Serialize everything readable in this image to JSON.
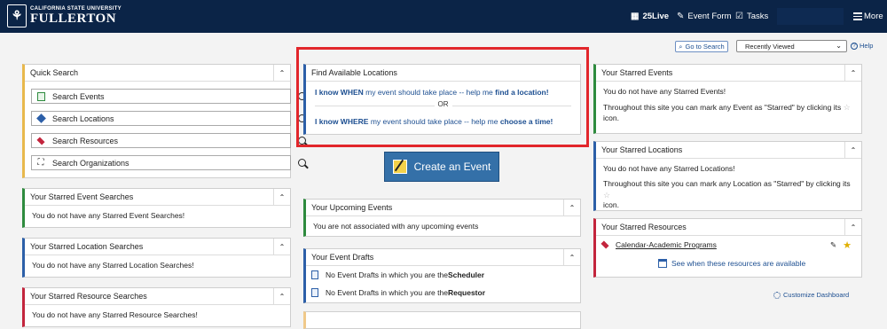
{
  "header": {
    "logo_small": "CALIFORNIA STATE UNIVERSITY",
    "logo_big": "FULLERTON",
    "nav_25live": "25Live",
    "nav_event_form": "Event Form",
    "nav_tasks": "Tasks",
    "nav_more": "More"
  },
  "toolbar": {
    "go_to_search": "Go to Search",
    "recently_viewed": "Recently Viewed",
    "help": "Help"
  },
  "quick_search": {
    "title": "Quick Search",
    "items": [
      {
        "label": "Search Events",
        "icon": "events-icon"
      },
      {
        "label": "Search Locations",
        "icon": "locations-cube-icon"
      },
      {
        "label": "Search Resources",
        "icon": "resources-diamond-icon"
      },
      {
        "label": "Search Organizations",
        "icon": "organizations-icon"
      }
    ]
  },
  "starred_event_searches": {
    "title": "Your Starred Event Searches",
    "body": "You do not have any Starred Event Searches!"
  },
  "starred_location_searches": {
    "title": "Your Starred Location Searches",
    "body": "You do not have any Starred Location Searches!"
  },
  "starred_resource_searches": {
    "title": "Your Starred Resource Searches",
    "body": "You do not have any Starred Resource Searches!"
  },
  "find_locations": {
    "title": "Find Available Locations",
    "line1_a": "I know WHEN",
    "line1_b": " my event should take place -- help me ",
    "line1_c": "find a location!",
    "or": "OR",
    "line2_a": "I know WHERE",
    "line2_b": " my event should take place -- help me ",
    "line2_c": "choose a time!"
  },
  "create_event": {
    "label": "Create an Event"
  },
  "upcoming_events": {
    "title": "Your Upcoming Events",
    "body": "You are not associated with any upcoming events"
  },
  "event_drafts": {
    "title": "Your Event Drafts",
    "row1_a": "No Event Drafts in which you are the ",
    "row1_b": "Scheduler",
    "row2_a": "No Event Drafts in which you are the ",
    "row2_b": "Requestor"
  },
  "starred_events": {
    "title": "Your Starred Events",
    "body1": "You do not have any Starred Events!",
    "body2": "Throughout this site you can mark any Event as \"Starred\" by clicking its",
    "body3": "icon."
  },
  "starred_locations": {
    "title": "Your Starred Locations",
    "body1": "You do not have any Starred Locations!",
    "body2": "Throughout this site you can mark any Location as \"Starred\" by clicking its",
    "body3": "icon."
  },
  "starred_resources": {
    "title": "Your Starred Resources",
    "resource": "Calendar-Academic Programs",
    "see_link": "See when these resources are available"
  },
  "customize": {
    "label": "Customize Dashboard"
  },
  "colors": {
    "header": "#0b2447",
    "link": "#1d4f91",
    "highlight": "#e2262b",
    "button": "#3470a8"
  }
}
